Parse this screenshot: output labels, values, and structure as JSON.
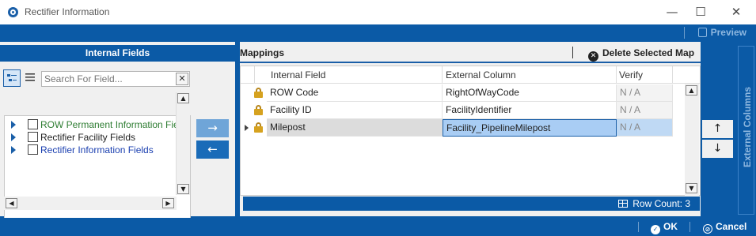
{
  "window": {
    "title": "Rectifier Information",
    "minimize": "—",
    "maximize": "☐",
    "close": "✕"
  },
  "toolbar": {
    "preview_label": "Preview"
  },
  "internal_fields": {
    "header": "Internal Fields",
    "search_placeholder": "Search For Field...",
    "clear_label": "✕",
    "items": [
      {
        "label": "ROW Permanent Information Fie",
        "color": "#2e7d32"
      },
      {
        "label": "Rectifier Facility Fields",
        "color": "#222222"
      },
      {
        "label": "Rectifier Information Fields",
        "color": "#1a3fb0"
      }
    ]
  },
  "transfer": {
    "right_arrow": "→",
    "left_arrow": "←"
  },
  "mappings": {
    "title": "Mappings",
    "delete_label": "Delete Selected Map",
    "columns": [
      "Internal Field",
      "External Column",
      "Verify"
    ],
    "rows": [
      {
        "internal": "ROW Code",
        "external": "RightOfWayCode",
        "verify": "N / A",
        "selected": false
      },
      {
        "internal": "Facility ID",
        "external": "FacilityIdentifier",
        "verify": "N / A",
        "selected": false
      },
      {
        "internal": "Milepost",
        "external": "Facility_PipelineMilepost",
        "verify": "N / A",
        "selected": true
      }
    ],
    "row_count_label": "Row Count:",
    "row_count": "3"
  },
  "reorder": {
    "up": "↑",
    "down": "↓"
  },
  "external_columns": {
    "label": "External Columns"
  },
  "actions": {
    "ok_label": "OK",
    "cancel_label": "Cancel"
  },
  "colors": {
    "accent": "#0b5aa6",
    "selected_cell": "#a9cdf4"
  }
}
